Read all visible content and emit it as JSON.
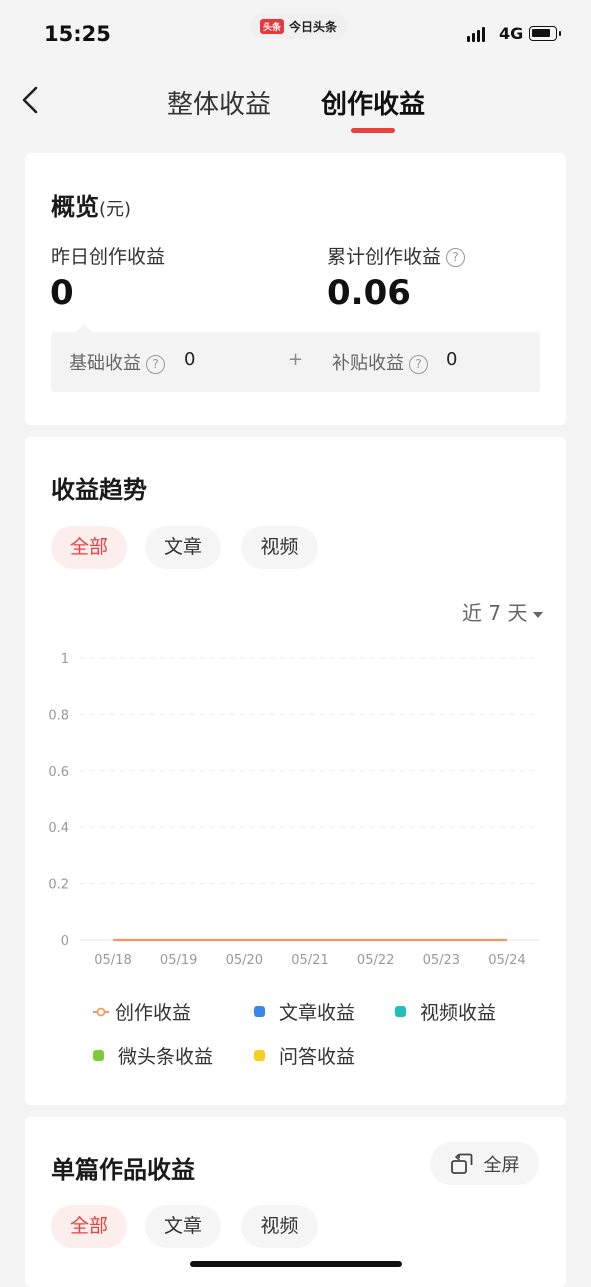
{
  "status_bar": {
    "time": "15:25",
    "app_logo": "头条",
    "app_name": "今日头条",
    "network": "4G"
  },
  "nav": {
    "back_icon": "chevron-left-icon",
    "tabs": [
      {
        "label": "整体收益"
      },
      {
        "label": "创作收益"
      }
    ]
  },
  "overview": {
    "title": "概览",
    "unit": "(元)",
    "yesterday_label": "昨日创作收益",
    "yesterday_value": "0",
    "total_label": "累计创作收益",
    "total_value": "0.06",
    "base_label": "基础收益",
    "base_value": "0",
    "plus": "+",
    "subsidy_label": "补贴收益",
    "subsidy_value": "0",
    "help_icon_glyph": "?"
  },
  "trend": {
    "title": "收益趋势",
    "filters": [
      "全部",
      "文章",
      "视频"
    ],
    "range_label": "近 7 天"
  },
  "chart_data": {
    "type": "line",
    "categories": [
      "05/18",
      "05/19",
      "05/20",
      "05/21",
      "05/22",
      "05/23",
      "05/24"
    ],
    "yticks": [
      "1",
      "0.8",
      "0.6",
      "0.4",
      "0.2",
      "0"
    ],
    "ylim": [
      0,
      1
    ],
    "grid": true,
    "legend_position": "bottom",
    "series": [
      {
        "name": "创作收益",
        "values": [
          0,
          0,
          0,
          0,
          0,
          0,
          0
        ],
        "color": "#f39a62"
      },
      {
        "name": "文章收益",
        "values": [],
        "color": "#3c86e8"
      },
      {
        "name": "视频收益",
        "values": [],
        "color": "#1fbfbf"
      },
      {
        "name": "微头条收益",
        "values": [],
        "color": "#7ecb3a"
      },
      {
        "name": "问答收益",
        "values": [],
        "color": "#f7cf23"
      }
    ]
  },
  "single": {
    "title": "单篇作品收益",
    "fullscreen_label": "全屏",
    "filters": [
      "全部",
      "文章",
      "视频"
    ]
  }
}
